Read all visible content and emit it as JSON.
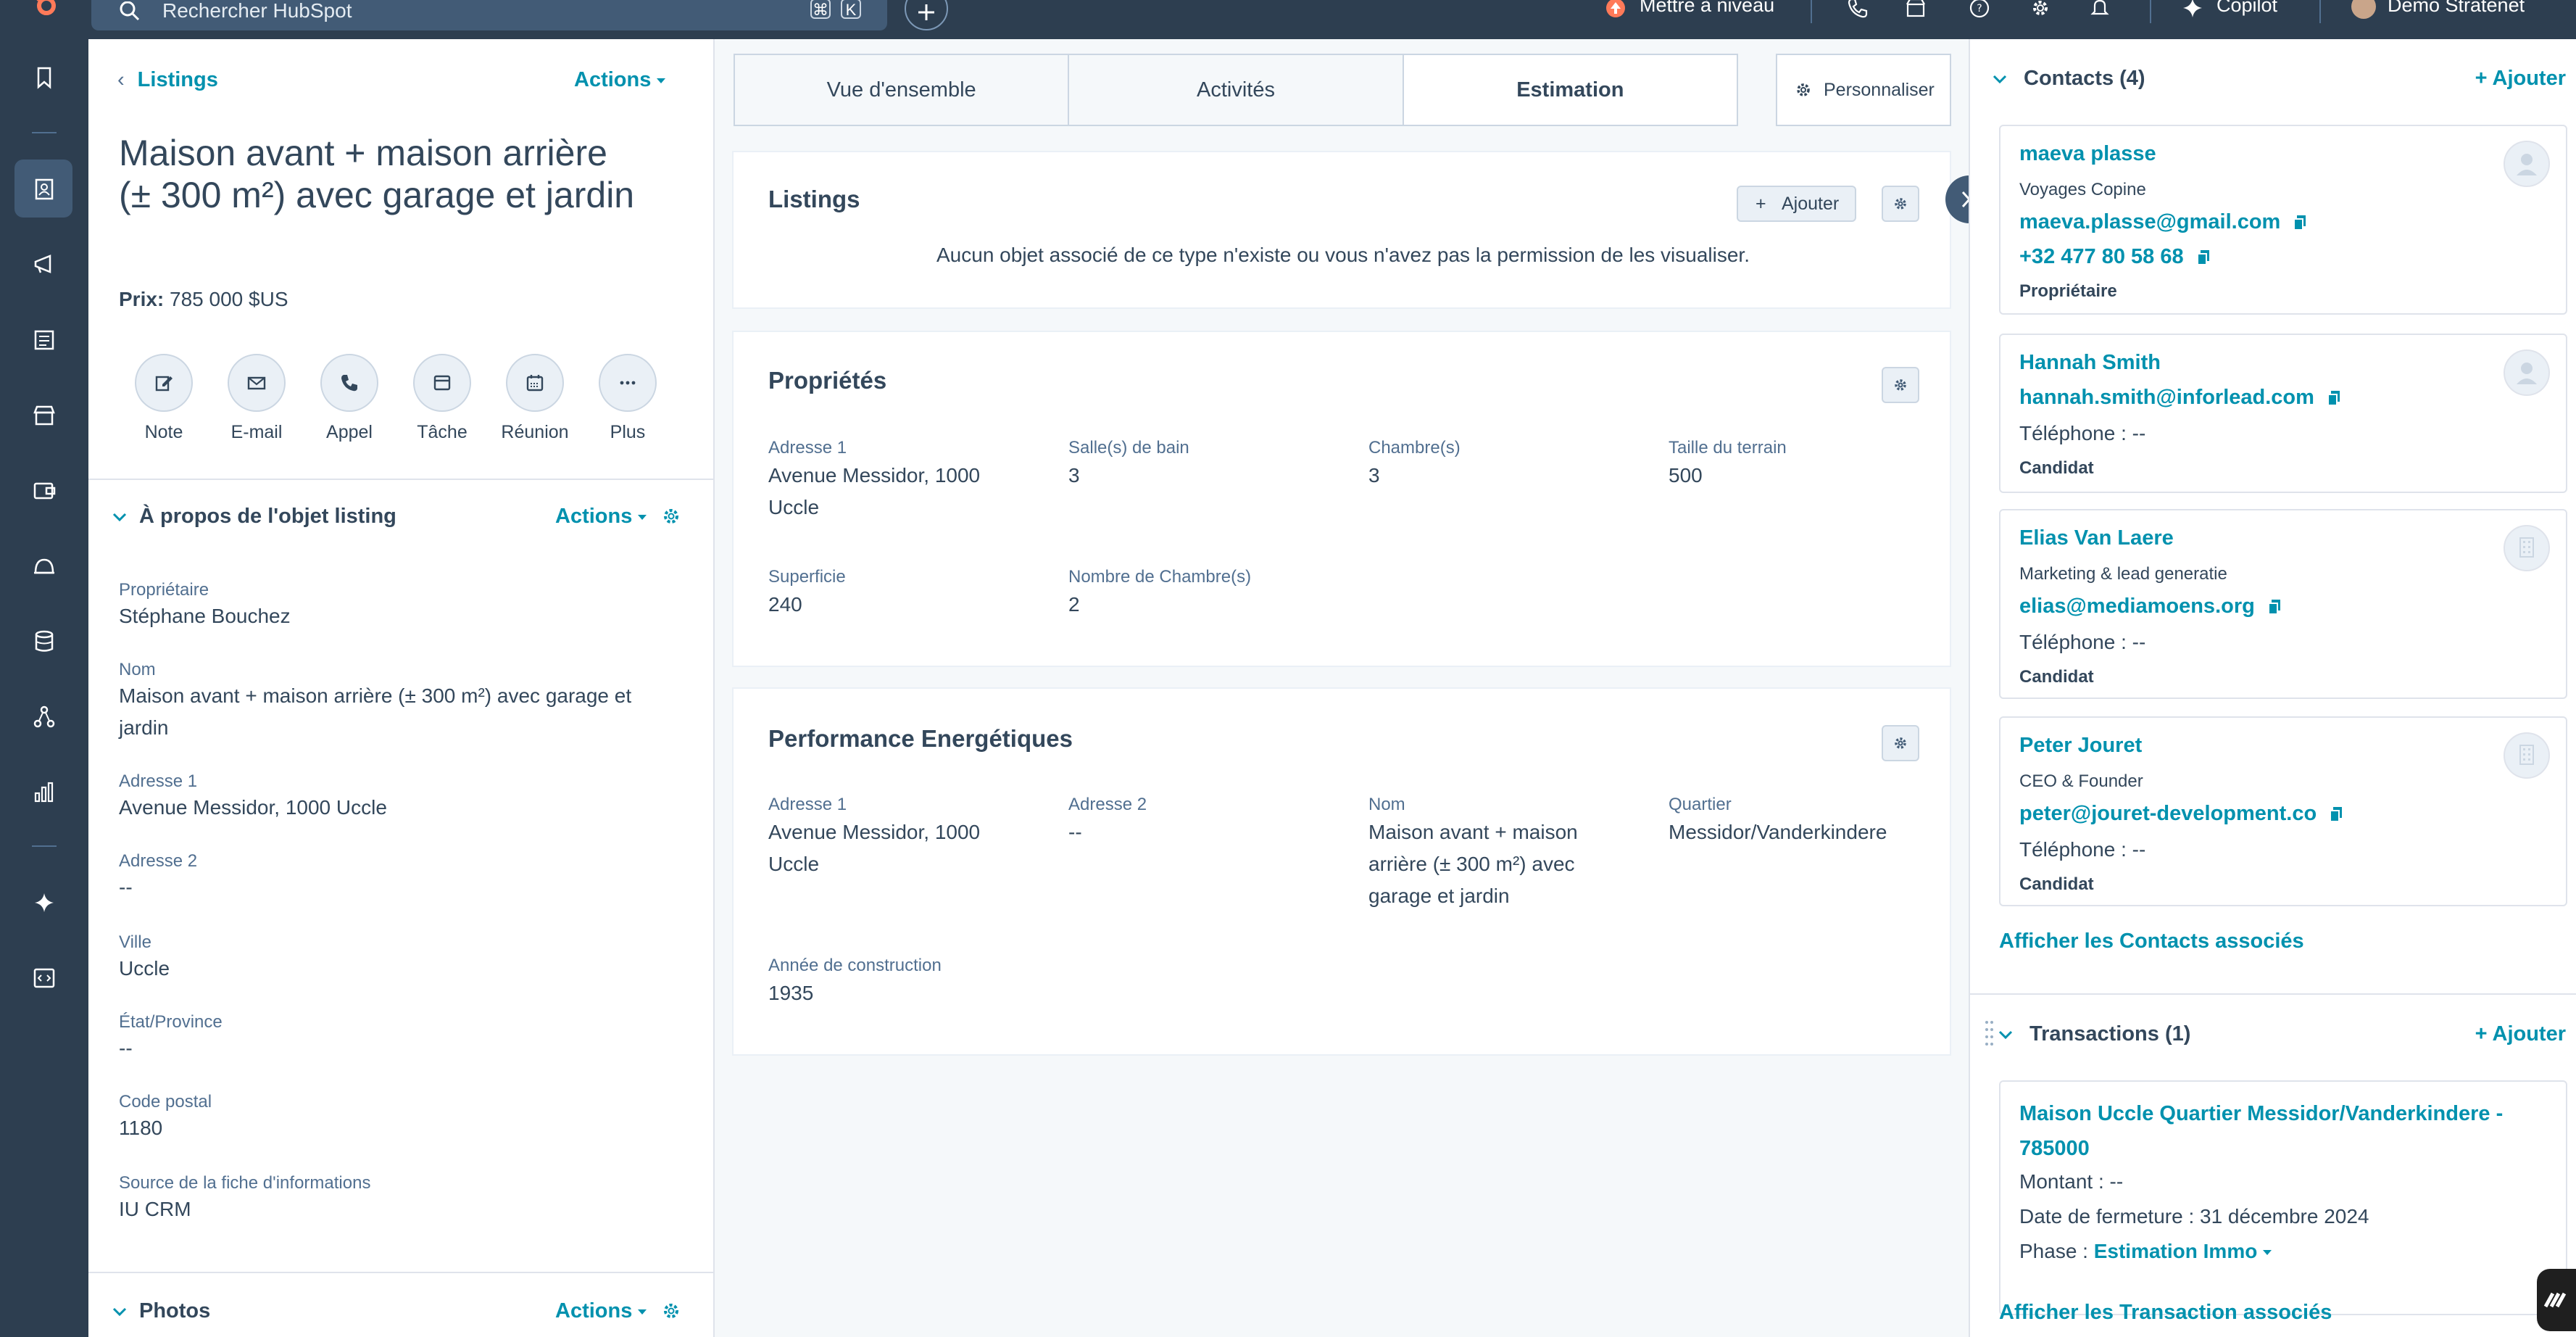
{
  "topbar": {
    "search_placeholder": "Rechercher HubSpot",
    "shortcut_keys": [
      "⌘",
      "K"
    ],
    "upgrade_label": "Mettre à niveau",
    "copilot_label": "Copilot",
    "account_name": "Demo Stratenet"
  },
  "record": {
    "back_label": "Listings",
    "actions_label": "Actions",
    "title": "Maison avant + maison arrière (± 300 m²) avec garage et jardin",
    "price_label": "Prix:",
    "price_value": "785 000 $US",
    "quick_actions": [
      "Note",
      "E-mail",
      "Appel",
      "Tâche",
      "Réunion",
      "Plus"
    ]
  },
  "about": {
    "title": "À propos de l'objet listing",
    "actions_label": "Actions",
    "properties": [
      {
        "label": "Propriétaire",
        "value": "Stéphane Bouchez"
      },
      {
        "label": "Nom",
        "value": "Maison avant + maison arrière (± 300 m²) avec garage et jardin"
      },
      {
        "label": "Adresse 1",
        "value": "Avenue Messidor, 1000 Uccle"
      },
      {
        "label": "Adresse 2",
        "value": "--"
      },
      {
        "label": "Ville",
        "value": "Uccle"
      },
      {
        "label": "État/Province",
        "value": "--"
      },
      {
        "label": "Code postal",
        "value": "1180"
      },
      {
        "label": "Source de la fiche d'informations",
        "value": "IU CRM"
      }
    ]
  },
  "photos": {
    "title": "Photos",
    "actions_label": "Actions"
  },
  "tabs": [
    "Vue d'ensemble",
    "Activités",
    "Estimation"
  ],
  "active_tab": "Estimation",
  "customize_label": "Personnaliser",
  "listings_card": {
    "title": "Listings",
    "add_label": "Ajouter",
    "empty_message": "Aucun objet associé de ce type n'existe ou vous n'avez pas la permission de les visualiser."
  },
  "properties_card": {
    "title": "Propriétés",
    "fields": [
      {
        "label": "Adresse 1",
        "value": "Avenue Messidor, 1000 Uccle"
      },
      {
        "label": "Salle(s) de bain",
        "value": "3"
      },
      {
        "label": "Chambre(s)",
        "value": "3"
      },
      {
        "label": "Taille du terrain",
        "value": "500"
      },
      {
        "label": "Superficie",
        "value": "240"
      },
      {
        "label": "Nombre de Chambre(s)",
        "value": "2"
      }
    ]
  },
  "energy_card": {
    "title": "Performance Energétiques",
    "fields": [
      {
        "label": "Adresse 1",
        "value": "Avenue Messidor, 1000 Uccle"
      },
      {
        "label": "Adresse 2",
        "value": "--"
      },
      {
        "label": "Nom",
        "value": "Maison avant + maison arrière (± 300 m²) avec garage et jardin"
      },
      {
        "label": "Quartier",
        "value": "Messidor/Vanderkindere"
      },
      {
        "label": "Année de construction",
        "value": "1935"
      }
    ]
  },
  "contacts": {
    "title": "Contacts (4)",
    "add_label": "+ Ajouter",
    "items": [
      {
        "name": "maeva plasse",
        "subtitle": "Voyages Copine",
        "email": "maeva.plasse@gmail.com",
        "phone": "+32 477 80 58 68",
        "role": "Propriétaire"
      },
      {
        "name": "Hannah Smith",
        "email": "hannah.smith@inforlead.com",
        "phone_text": "Téléphone : --",
        "role": "Candidat"
      },
      {
        "name": "Elias Van Laere",
        "subtitle": "Marketing & lead generatie",
        "email": "elias@mediamoens.org",
        "phone_text": "Téléphone : --",
        "role": "Candidat"
      },
      {
        "name": "Peter Jouret",
        "subtitle": "CEO & Founder",
        "email": "peter@jouret-development.co",
        "phone_text": "Téléphone : --",
        "role": "Candidat"
      }
    ],
    "view_all": "Afficher les Contacts associés"
  },
  "deals": {
    "title": "Transactions (1)",
    "add_label": "+ Ajouter",
    "deal_name": "Maison Uccle Quartier Messidor/Vanderkindere - 785000",
    "amount_text": "Montant : --",
    "close_date_text": "Date de fermeture : 31 décembre 2024",
    "phase_label": "Phase :",
    "phase_value": "Estimation Immo",
    "view_all": "Afficher les Transaction associés"
  },
  "colors": {
    "nav_bg": "#2d3e50",
    "link": "#0091ae",
    "text": "#33475b",
    "accent": "#ff7a59"
  }
}
